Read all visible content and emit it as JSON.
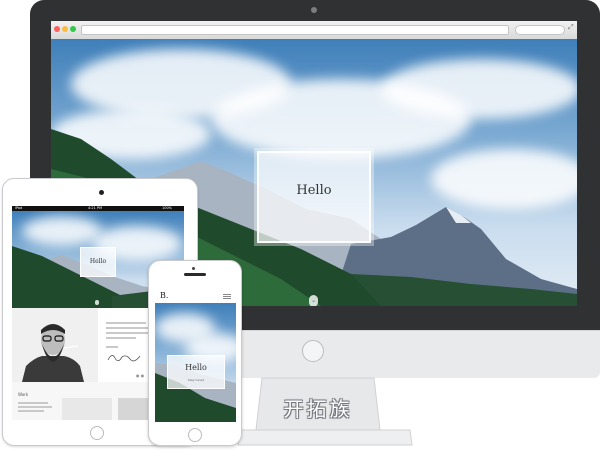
{
  "desktop": {
    "browser": {
      "address_text": "",
      "nav_glyph": "◂ ▸",
      "expand_glyph": "⤢",
      "dot_colors": [
        "#fc605c",
        "#fdbc40",
        "#34c84a"
      ]
    },
    "hello": "Hello",
    "scroll_glyph": "⌄"
  },
  "tablet": {
    "status": {
      "left": "iPad",
      "time": "4:21 PM",
      "right": "100%"
    },
    "hello": "Hello",
    "section_label": "Work",
    "pager": "● ●"
  },
  "phone": {
    "logo": "B.",
    "hello": "Hello",
    "subtitle": "Stay tuned"
  },
  "watermark": "开拓族",
  "colors": {
    "bezel": "#2f3133",
    "chin": "#e9eaec",
    "forest": "#1f4a2c",
    "mountain": "#5c6f86"
  },
  "icons": [
    "browser-back-icon",
    "browser-expand-icon",
    "scroll-down-icon",
    "hamburger-menu-icon"
  ]
}
